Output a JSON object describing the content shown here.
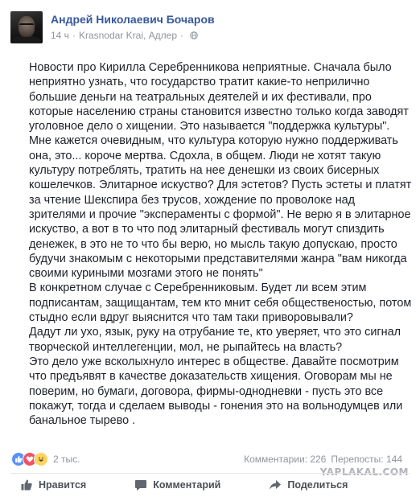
{
  "post": {
    "author": "Андрей Николаевич Бочаров",
    "time": "14 ч",
    "location": "Krasnodar Krai, Адлер",
    "paragraphs": [
      "Новости про Кирилла Серебренникова неприятные. Сначала было неприятно узнать, что государство тратит какие-то неприлично большие деньги на театральных деятелей и их фестивали, про которые населению страны становится известно только когда заводят уголовное дело о хищении. Это называется \"поддержка культуры\". Мне кажется очевидным, что культура которую нужно поддерживать она, это... короче мертва. Сдохла, в общем. Люди не хотят такую культуру потреблять, тратить на нее денешки из своих бисерных кошелечков. Элитарное искуство? Для эстетов? Пусть эстеты и платят за чтение Шекспира без трусов, хождение по проволоке над зрителями и прочие \"экспераменты с формой\". Не верю я в элитарное искуство, а вот в то что под элитарный фестиваль могут спиздить денежек, в это не то что бы верю, но мысль такую допускаю, просто будучи знакомым с некоторыми представителями жанра \"вам никогда своими куриными мозгами этого не понять\"",
      "В конкретном случае с Серебренниковым. Будет ли всем этим подписантам, защищантам, тем кто мнит себя общественостью, потом стыдно если вдруг выяснится что там таки приворовывали?",
      "Дадут ли ухо, язык, руку на отрубание те, кто уверяет, что это сигнал творческой интеллегенции, мол, не рыпайтесь на власть?",
      "Это дело уже всколыхнуло интерес в обществе. Давайте посмотрим что предъявят в качестве доказательств хищения. Оговорам мы не поверим, но бумаги, договора, фирмы-однодневки - пусть это все покажут, тогда и сделаем выводы - гонения это на вольнодумцев или банальное тырево ."
    ],
    "reactions_count": "2 тыс.",
    "comments": "Комментарии: 226",
    "shares": "Перепосты: 144"
  },
  "actions": {
    "like": "Нравится",
    "comment": "Комментарий",
    "share": "Поделиться"
  },
  "watermark": "YAPLAKAL.COM",
  "icons": [
    "globe-icon",
    "like-reaction-icon",
    "love-reaction-icon",
    "haha-reaction-icon",
    "thumbs-up-icon",
    "comment-icon",
    "share-icon"
  ],
  "colors": {
    "author": "#365899",
    "muted": "#90949c",
    "like": "#5890ff",
    "love": "#f25268",
    "haha": "#fcd462"
  }
}
